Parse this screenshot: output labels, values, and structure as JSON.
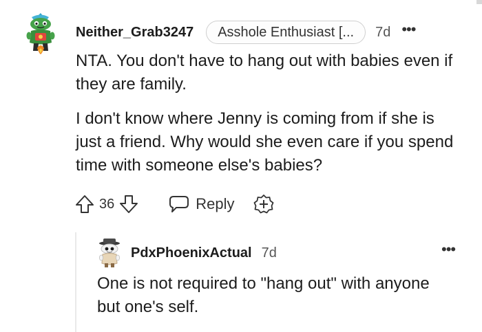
{
  "comment": {
    "username": "Neither_Grab3247",
    "flair": "Asshole Enthusiast [...",
    "timestamp": "7d",
    "more_label": "•••",
    "avatar_icon": "snoo-avatar-green-icon",
    "paragraphs": [
      "NTA. You don't have to hang out with babies even if they are family.",
      "I don't know where Jenny is coming from if she is just a friend. Why would she even care if you spend time with someone else's babies?"
    ],
    "vote_count": "36",
    "reply_label": "Reply",
    "icons": {
      "upvote": "upvote-arrow-icon",
      "downvote": "downvote-arrow-icon",
      "reply": "speech-bubble-icon",
      "award": "award-plus-icon"
    }
  },
  "reply": {
    "username": "PdxPhoenixActual",
    "timestamp": "7d",
    "more_label": "•••",
    "avatar_icon": "snoo-avatar-hat-icon",
    "body": "One is not required to \"hang out\" with anyone but one's self."
  },
  "colors": {
    "text": "#1c1c1c",
    "meta": "#555555",
    "thread_line": "#e9e9e9",
    "flair_border": "#cfcfcf"
  }
}
